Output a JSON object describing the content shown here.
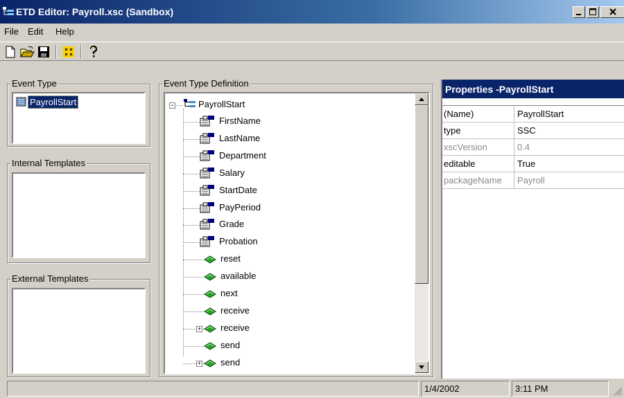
{
  "window": {
    "title": "ETD Editor: Payroll.xsc (Sandbox)"
  },
  "menu": [
    "File",
    "Edit",
    "Help"
  ],
  "toolbar": [
    "new-file-icon",
    "open-folder-icon",
    "save-disk-icon",
    "grid-icon",
    "help-icon"
  ],
  "panels": {
    "event_type": {
      "label": "Event Type",
      "items": [
        "PayrollStart"
      ],
      "selected": "PayrollStart"
    },
    "internal_templates": {
      "label": "Internal Templates",
      "items": []
    },
    "external_templates": {
      "label": "External Templates",
      "items": []
    },
    "definition": {
      "label": "Event Type Definition",
      "root": "PayrollStart",
      "fields": [
        "FirstName",
        "LastName",
        "Department",
        "Salary",
        "StartDate",
        "PayPeriod",
        "Grade",
        "Probation"
      ],
      "methods": [
        {
          "label": "reset",
          "expandable": false
        },
        {
          "label": "available",
          "expandable": false
        },
        {
          "label": "next",
          "expandable": false
        },
        {
          "label": "receive",
          "expandable": false
        },
        {
          "label": "receive",
          "expandable": true
        },
        {
          "label": "send",
          "expandable": false
        },
        {
          "label": "send",
          "expandable": true
        }
      ]
    }
  },
  "properties": {
    "title": "Properties -PayrollStart",
    "rows": [
      {
        "key": "(Name)",
        "value": "PayrollStart",
        "enabled": true
      },
      {
        "key": "type",
        "value": "SSC",
        "enabled": true
      },
      {
        "key": "xscVersion",
        "value": "0.4",
        "enabled": false
      },
      {
        "key": "editable",
        "value": "True",
        "enabled": true
      },
      {
        "key": "packageName",
        "value": "Payroll",
        "enabled": false
      }
    ]
  },
  "status": {
    "message": "",
    "date": "1/4/2002",
    "time": "3:11 PM"
  }
}
